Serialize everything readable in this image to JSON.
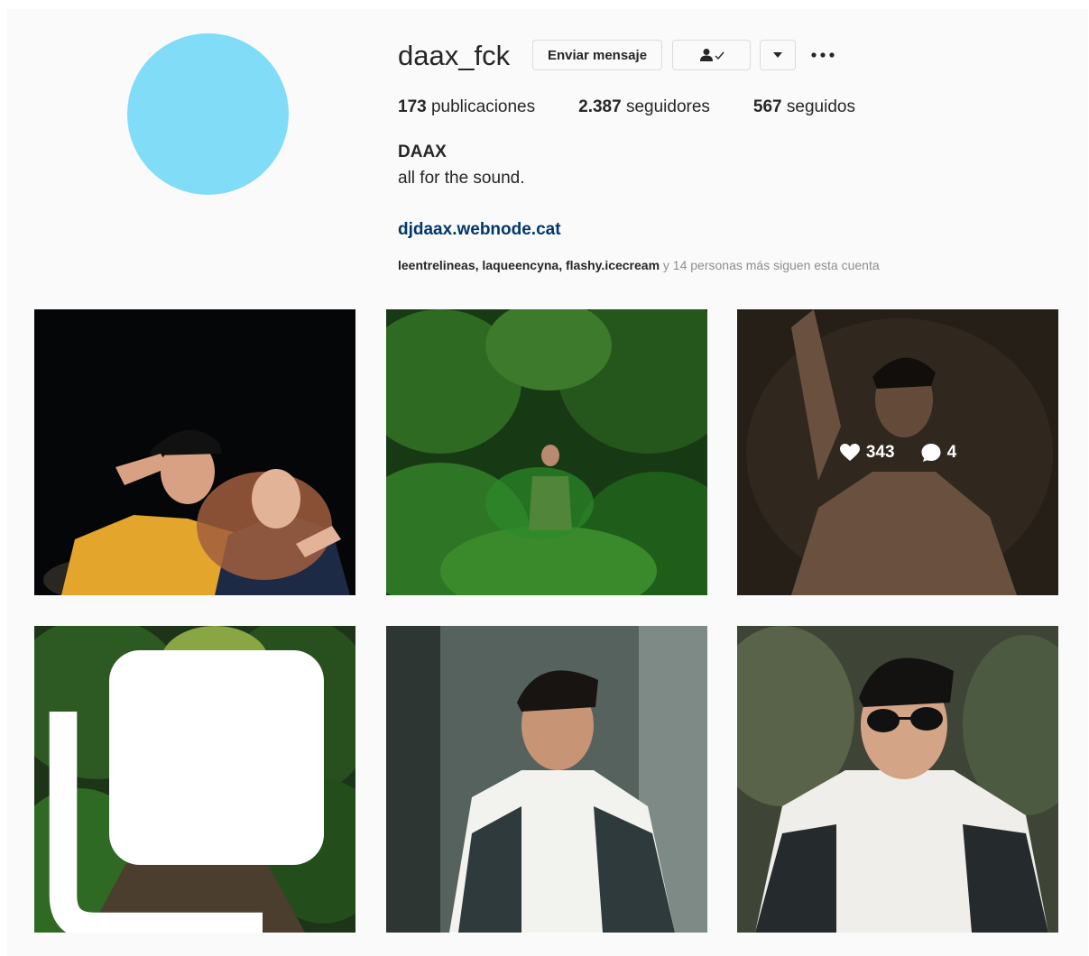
{
  "profile": {
    "username": "daax_fck",
    "message_button": "Enviar mensaje",
    "follow_icon": "user-check-icon",
    "stats": {
      "posts_count": "173",
      "posts_label": "publicaciones",
      "followers_count": "2.387",
      "followers_label": "seguidores",
      "following_count": "567",
      "following_label": "seguidos"
    },
    "full_name": "DAAX",
    "bio": "all for the sound.",
    "website": "djdaax.webnode.cat",
    "followed_by": {
      "names": [
        "leentrelineas",
        "laqueencyna",
        "flashy.icecream"
      ],
      "suffix": "y 14 personas más siguen esta cuenta"
    },
    "avatar_color": "#81dcf8"
  },
  "posts": [
    {
      "id": "post-1"
    },
    {
      "id": "post-2"
    },
    {
      "id": "post-3",
      "likes": "343",
      "comments": "4"
    },
    {
      "id": "post-4",
      "multi": true
    },
    {
      "id": "post-5"
    },
    {
      "id": "post-6"
    }
  ]
}
